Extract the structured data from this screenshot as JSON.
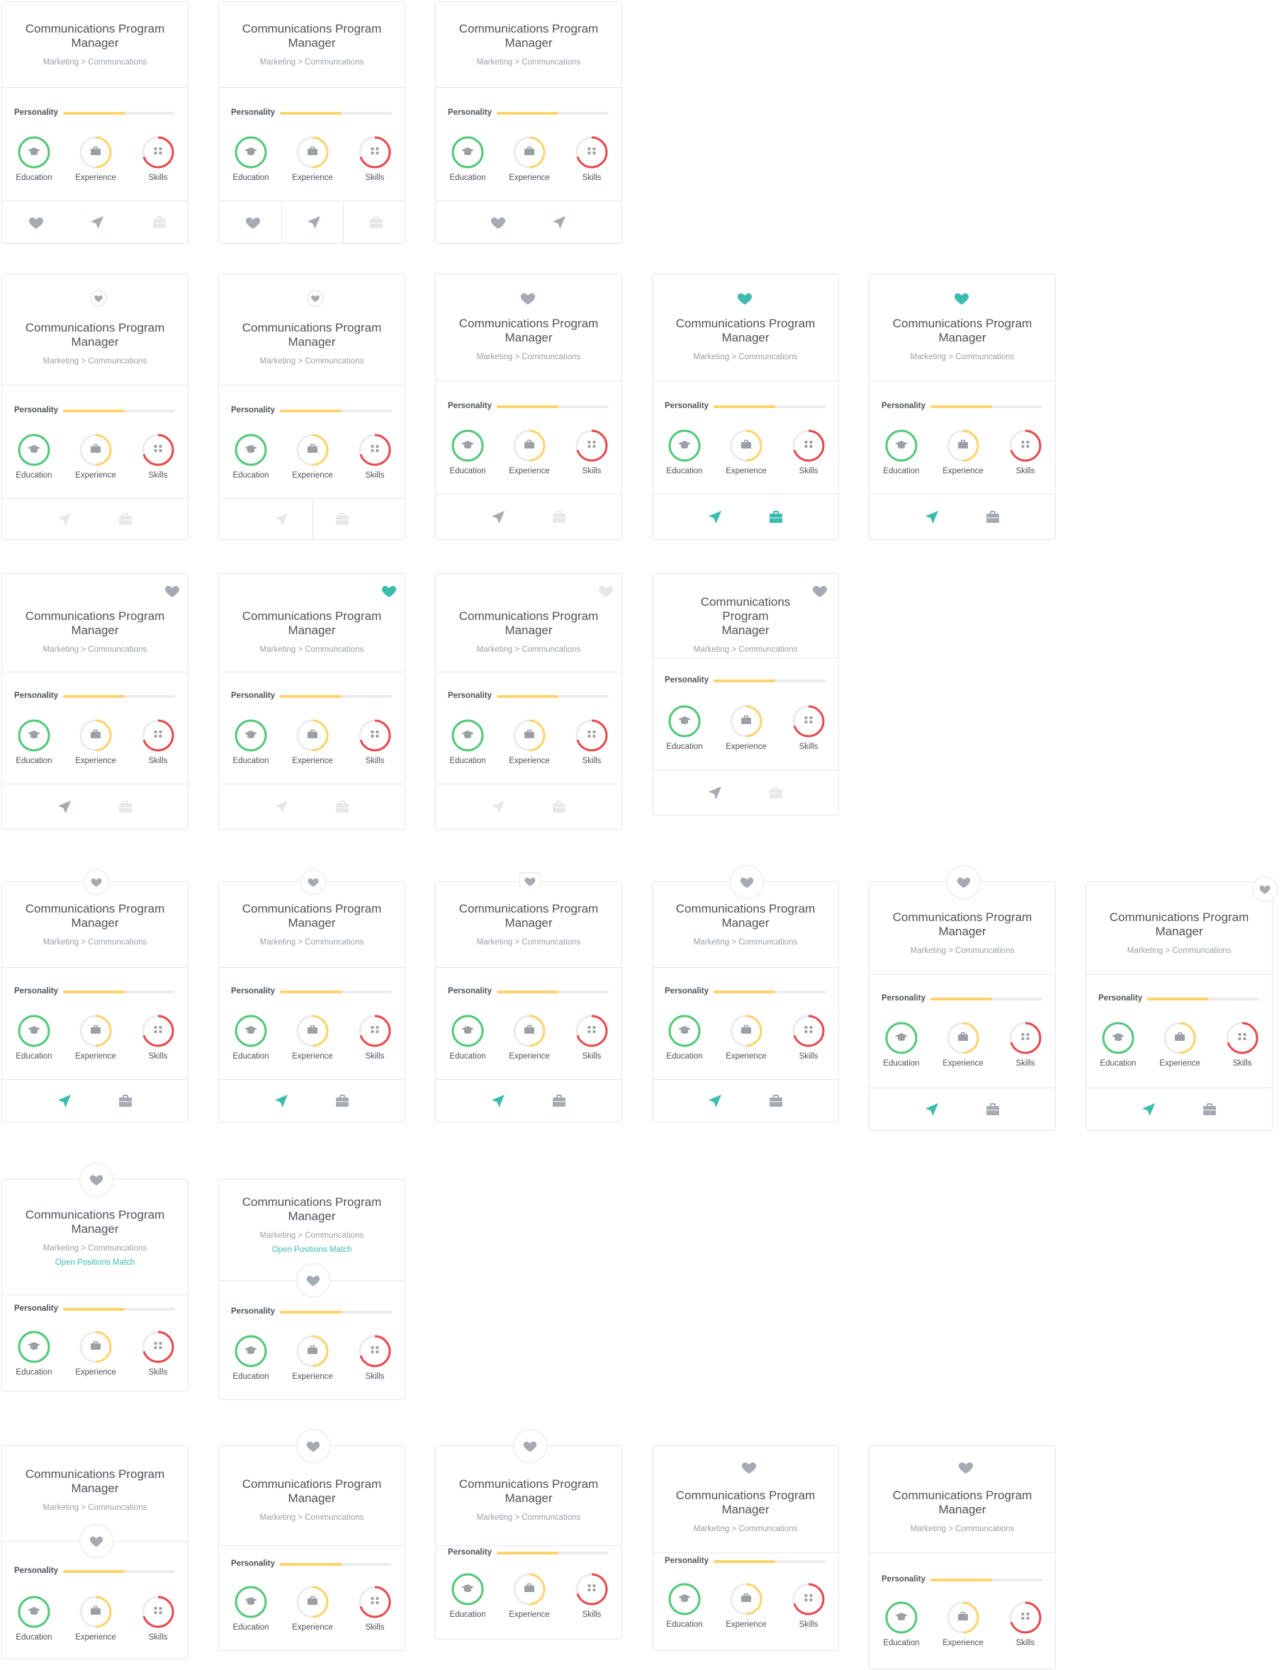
{
  "job": {
    "title": "Communications Program Manager",
    "title_line1": "Communications Program",
    "title_line2": "Manager",
    "breadcrumb": "Marketing > Communcations",
    "match_text": "Open Positions Match"
  },
  "personality": {
    "label": "Personality",
    "level": 0.55
  },
  "metrics": [
    {
      "label": "Education",
      "level": 1.0,
      "color": "#52c878",
      "icon": "graduation-cap-icon"
    },
    {
      "label": "Experience",
      "level": 0.5,
      "color": "#ffd36b",
      "icon": "briefcase-icon"
    },
    {
      "label": "Skills",
      "level": 0.7,
      "color": "#e8474c",
      "icon": "grid-icon"
    }
  ],
  "colors": {
    "accent": "#3bbcae",
    "muted": "#a5abb3",
    "faint": "#e6e8ea",
    "border": "#e4e6e8"
  },
  "icons": [
    "heart-icon",
    "send-icon",
    "briefcase-icon"
  ]
}
